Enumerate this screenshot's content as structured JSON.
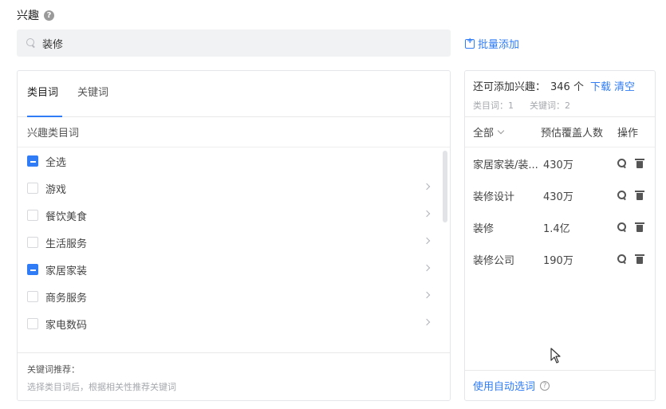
{
  "header": {
    "title": "兴趣"
  },
  "search": {
    "value": "装修",
    "placeholder": ""
  },
  "batch_add_label": "批量添加",
  "left_panel": {
    "tabs": [
      {
        "label": "类目词",
        "active": true
      },
      {
        "label": "关键词",
        "active": false
      }
    ],
    "section_title": "兴趣类目词",
    "categories": [
      {
        "label": "全选",
        "state": "partial",
        "has_children": false
      },
      {
        "label": "游戏",
        "state": "unchecked",
        "has_children": true
      },
      {
        "label": "餐饮美食",
        "state": "unchecked",
        "has_children": true
      },
      {
        "label": "生活服务",
        "state": "unchecked",
        "has_children": true
      },
      {
        "label": "家居家装",
        "state": "partial",
        "has_children": true
      },
      {
        "label": "商务服务",
        "state": "unchecked",
        "has_children": true
      },
      {
        "label": "家电数码",
        "state": "unchecked",
        "has_children": true
      }
    ],
    "recommend": {
      "title": "关键词推荐：",
      "hint": "选择类目词后，根据相关性推荐关键词"
    }
  },
  "right_panel": {
    "remaining_label": "还可添加兴趣：",
    "remaining_count": "346 个",
    "download_label": "下载",
    "clear_label": "清空",
    "category_count": "类目词：1",
    "keyword_count": "关键词：2",
    "filter_label": "全部",
    "col_coverage": "预估覆盖人数",
    "col_action": "操作",
    "rows": [
      {
        "name": "家居家装/装...",
        "coverage": "430万"
      },
      {
        "name": "装修设计",
        "coverage": "430万"
      },
      {
        "name": "装修",
        "coverage": "1.4亿"
      },
      {
        "name": "装修公司",
        "coverage": "190万"
      }
    ],
    "auto_select_label": "使用自动选词"
  },
  "colors": {
    "accent": "#2f7cf6",
    "border": "#e4e6ea",
    "muted": "#a5a8ad"
  }
}
